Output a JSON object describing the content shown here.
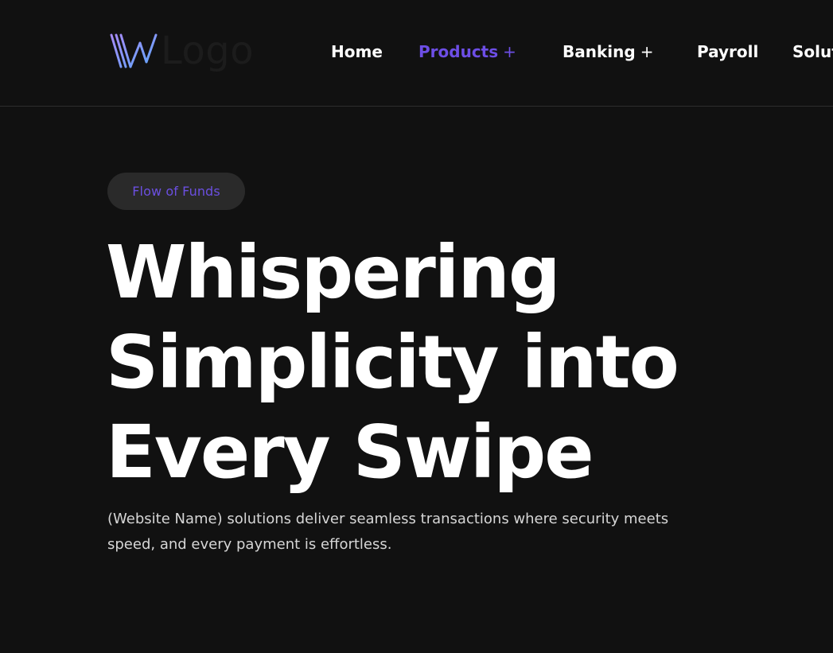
{
  "header": {
    "logo_text": "Logo",
    "nav": [
      {
        "label": "Home",
        "plus": ""
      },
      {
        "label": "Products",
        "plus": "+"
      },
      {
        "label": "Banking",
        "plus": "+"
      },
      {
        "label": "Payroll",
        "plus": ""
      },
      {
        "label": "Solut",
        "plus": ""
      }
    ]
  },
  "hero": {
    "badge": "Flow of Funds",
    "headline_lines": [
      "Whispering",
      "Simplicity into",
      "Every Swipe"
    ],
    "subtext_lines": [
      "(Website Name) solutions deliver seamless transactions where security meets",
      "speed, and every payment is effortless."
    ]
  },
  "colors": {
    "background": "#111111",
    "accent": "#6d4ee6",
    "text": "#ffffff",
    "badge_bg": "#2a2a2a"
  },
  "icons": {
    "logo_mark": "w-logo-icon"
  }
}
